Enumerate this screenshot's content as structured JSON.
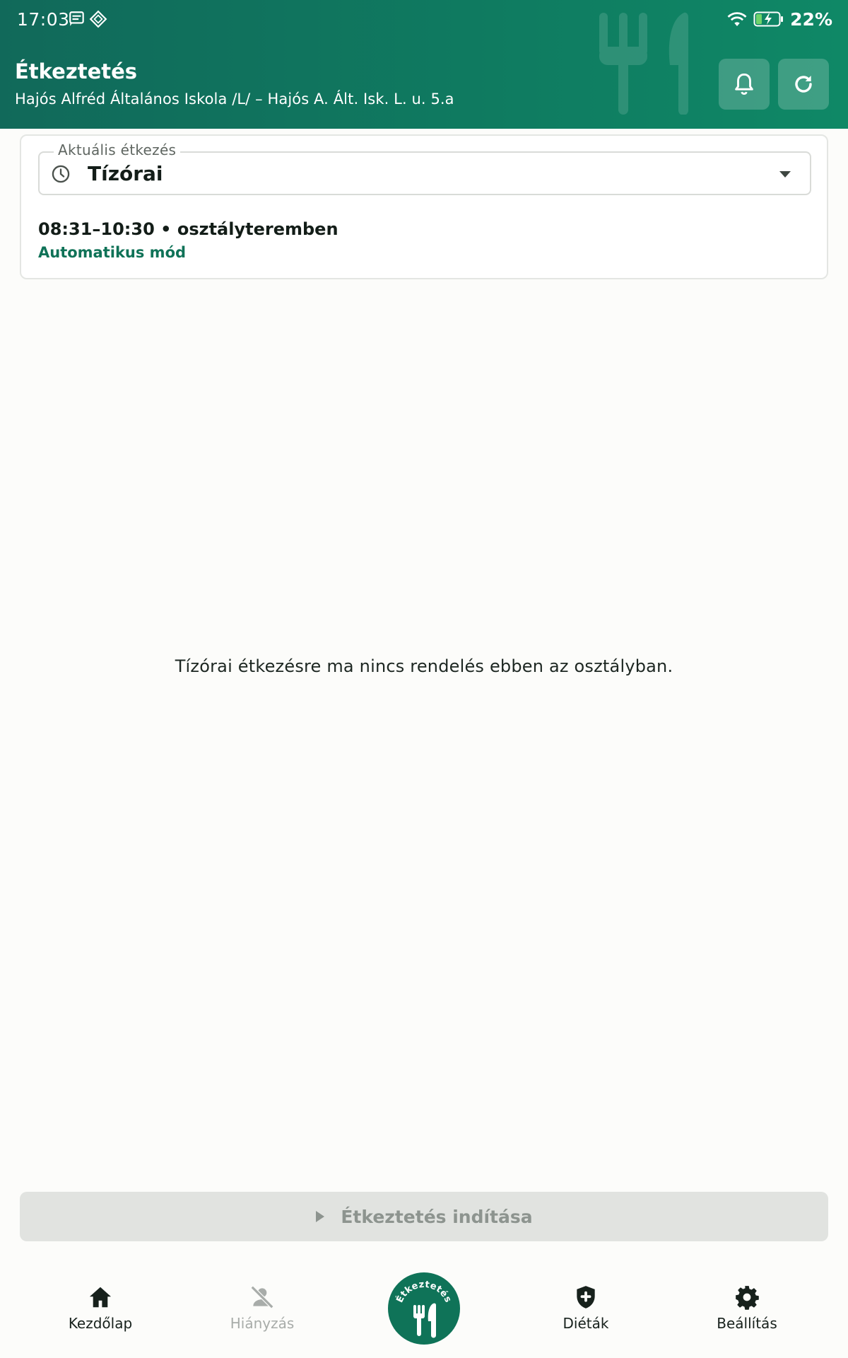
{
  "status_bar": {
    "time": "17:03",
    "battery": "22%"
  },
  "header": {
    "title": "Étkeztetés",
    "subtitle": "Hajós Alfréd Általános Iskola /L/ – Hajós A. Ált. Isk.  L. u. 5.a",
    "icons": [
      "bell-icon",
      "refresh-icon"
    ]
  },
  "meal_selector": {
    "legend": "Aktuális étkezés",
    "selected": "Tízórai",
    "time_location": "08:31–10:30 • osztályteremben",
    "mode": "Automatikus mód"
  },
  "empty_message": "Tízórai étkezésre ma nincs rendelés ebben az osztályban.",
  "start_button": {
    "label": "Étkeztetés indítása",
    "enabled": false
  },
  "bottom_nav": {
    "items": [
      {
        "label": "Kezdőlap",
        "icon": "home-icon"
      },
      {
        "label": "Hiányzás",
        "icon": "person-off-icon",
        "disabled": true
      },
      {
        "label": "Étkeztetés",
        "icon": "cutlery-icon",
        "active": true
      },
      {
        "label": "Diéták",
        "icon": "shield-plus-icon"
      },
      {
        "label": "Beállítás",
        "icon": "gear-icon"
      }
    ]
  },
  "colors": {
    "primary": "#0f7358",
    "header_gradient_start": "#11695a",
    "header_gradient_end": "#0f8866",
    "mode_text": "#0f7257",
    "disabled_button": "#e1e3e0"
  }
}
